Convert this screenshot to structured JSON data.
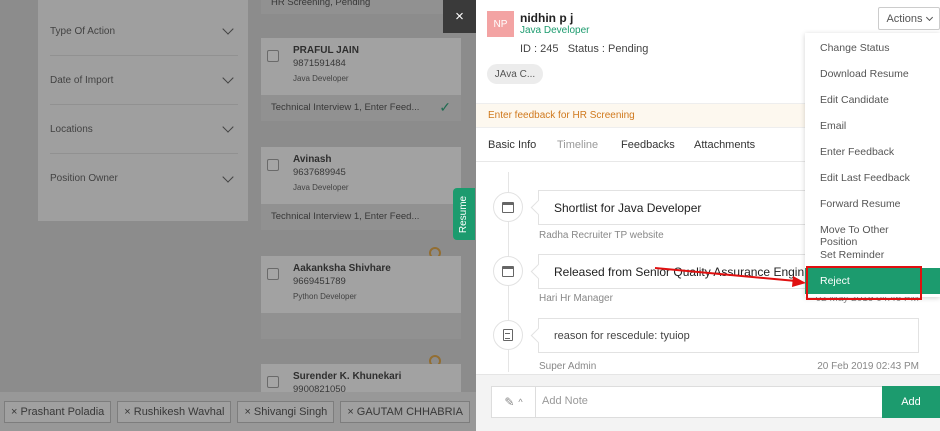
{
  "background": {
    "top_stage_partial": "HR Screening, Pending",
    "filters": [
      {
        "label": "Type Of Action"
      },
      {
        "label": "Date of Import"
      },
      {
        "label": "Locations"
      },
      {
        "label": "Position Owner"
      }
    ],
    "candidates": [
      {
        "name": "PRAFUL JAIN",
        "phone": "9871591484",
        "role": "Java Developer",
        "stage": "Technical Interview 1, Enter Feed..."
      },
      {
        "name": "Avinash",
        "phone": "9637689945",
        "role": "Java Developer",
        "stage": "Technical Interview 1, Enter Feed..."
      },
      {
        "name": "Aakanksha Shivhare",
        "phone": "9669451789",
        "role": "Python Developer",
        "stage": ""
      },
      {
        "name": "Surender K. Khunekari",
        "phone": "9900821050",
        "role": "",
        "stage": ""
      }
    ],
    "resume_tab": "Resume",
    "close_glyph": "×",
    "chips": [
      "× Prashant Poladia",
      "× Rushikesh Wavhal",
      "× Shivangi Singh",
      "× GAUTAM CHHABRIA"
    ]
  },
  "drawer": {
    "avatar": "NP",
    "name": "nidhin p j",
    "role": "Java Developer",
    "id_status": "ID : 245   Status : Pending",
    "tag": "JAva C...",
    "actions_label": "Actions",
    "feedback_banner": "Enter feedback for HR Screening",
    "tabs": [
      "Basic Info",
      "Timeline",
      "Feedbacks",
      "Attachments"
    ],
    "timeline": [
      {
        "title": "Shortlist for Java Developer",
        "meta": "Radha Recruiter TP website",
        "date": ""
      },
      {
        "title": "Released from Senior Quality Assurance Engin...",
        "meta": "Hari Hr Manager",
        "date": "02 May 2019 04:46 PM"
      },
      {
        "title": "reason for rescedule: tyuiop",
        "meta": "Super Admin",
        "date": "20 Feb 2019 02:43 PM"
      }
    ],
    "note_placeholder": "Add Note",
    "add_label": "Add",
    "menu": [
      "Change Status",
      "Download Resume",
      "Edit Candidate",
      "Email",
      "Enter Feedback",
      "Edit Last Feedback",
      "Forward Resume",
      "Move To Other Position",
      "Set Reminder",
      "Reject"
    ]
  },
  "colors": {
    "accent": "#1c9b6e",
    "warning": "#d0791d",
    "highlight": "#e01010"
  }
}
